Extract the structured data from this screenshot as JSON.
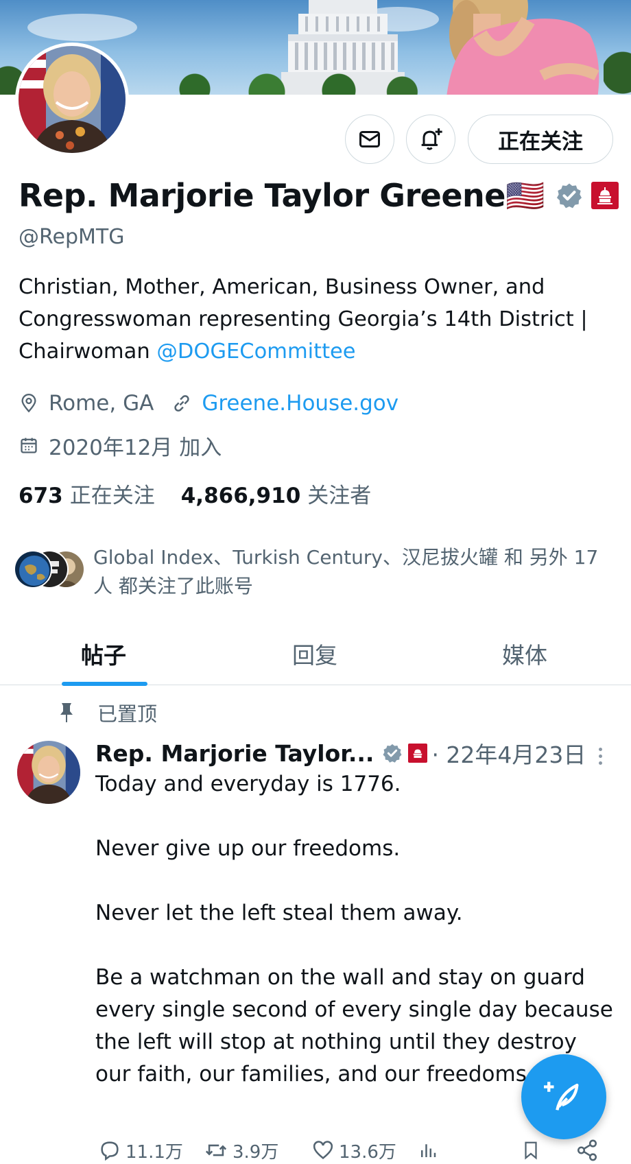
{
  "profile": {
    "name": "Rep. Marjorie Taylor Greene🇺🇸",
    "handle": "@RepMTG",
    "follow_label": "正在关注",
    "bio_text": "Christian, Mother, American, Business Owner, and Congresswoman representing Georgia’s 14th District | Chairwoman ",
    "bio_mention": "@DOGECommittee",
    "location": "Rome, GA",
    "website": "Greene.House.gov",
    "joined": "2020年12月 加入",
    "following_count": "673",
    "following_label": "正在关注",
    "followers_count": "4,866,910",
    "followers_label": "关注者",
    "followed_by": "Global Index、Turkish Century、汉尼拔火罐 和 另外 17 人 都关注了此账号"
  },
  "tabs": [
    {
      "label": "帖子",
      "active": true
    },
    {
      "label": "回复",
      "active": false
    },
    {
      "label": "媒体",
      "active": false
    }
  ],
  "tweet": {
    "pinned_label": "已置顶",
    "author": "Rep. Marjorie Taylor...",
    "date": "· 22年4月23日",
    "paragraphs": [
      "Today and everyday is 1776.",
      "Never give up our freedoms.",
      "Never let the left steal them away.",
      "Be a watchman on the wall and stay on guard every single second of every single day because the left will stop at nothing until they destroy our faith, our families, and our freedoms."
    ],
    "replies": "11.1万",
    "retweets": "3.9万",
    "likes": "13.6万"
  },
  "icons": [
    "message-icon",
    "notification-bell-icon",
    "verified-badge-icon",
    "house-badge-icon",
    "location-icon",
    "link-icon",
    "calendar-icon",
    "pin-icon",
    "more-icon",
    "reply-icon",
    "retweet-icon",
    "like-icon",
    "views-icon",
    "bookmark-icon",
    "share-icon",
    "compose-icon"
  ],
  "colors": {
    "accent": "#1d9bf0",
    "text": "#0f1419",
    "muted": "#536471",
    "house_red": "#c8102e"
  }
}
